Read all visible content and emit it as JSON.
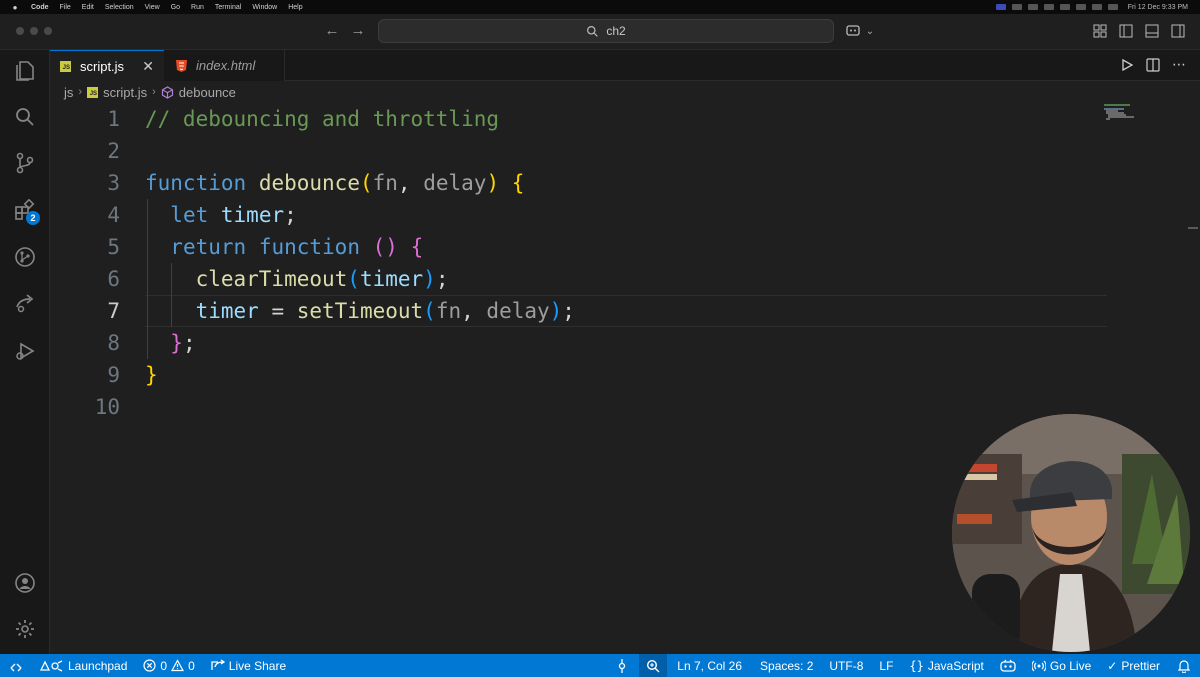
{
  "menubar": {
    "app": "Code",
    "items": [
      "File",
      "Edit",
      "Selection",
      "View",
      "Go",
      "Run",
      "Terminal",
      "Window",
      "Help"
    ],
    "clock": "Fri 12 Dec 9:33 PM"
  },
  "titlebar": {
    "search_text": "ch2"
  },
  "activitybar": {
    "extensions_badge": "2"
  },
  "tabs": [
    {
      "label": "script.js",
      "active": true
    },
    {
      "label": "index.html",
      "active": false
    }
  ],
  "breadcrumb": {
    "folder": "js",
    "file": "script.js",
    "symbol": "debounce"
  },
  "editor": {
    "current_line": 7,
    "line_numbers": [
      "1",
      "2",
      "3",
      "4",
      "5",
      "6",
      "7",
      "8",
      "9",
      "10"
    ],
    "lines": [
      [
        {
          "t": "// debouncing and throttling",
          "c": "com"
        }
      ],
      [],
      [
        {
          "t": "function",
          "c": "kw"
        },
        {
          "t": " ",
          "c": "plain"
        },
        {
          "t": "debounce",
          "c": "fn"
        },
        {
          "t": "(",
          "c": "p1"
        },
        {
          "t": "fn",
          "c": "dim"
        },
        {
          "t": ", ",
          "c": "plain"
        },
        {
          "t": "delay",
          "c": "dim"
        },
        {
          "t": ")",
          "c": "p1"
        },
        {
          "t": " ",
          "c": "plain"
        },
        {
          "t": "{",
          "c": "p1"
        }
      ],
      [
        {
          "t": "  ",
          "c": "plain"
        },
        {
          "t": "let",
          "c": "kw"
        },
        {
          "t": " ",
          "c": "plain"
        },
        {
          "t": "timer",
          "c": "par"
        },
        {
          "t": ";",
          "c": "plain"
        }
      ],
      [
        {
          "t": "  ",
          "c": "plain"
        },
        {
          "t": "return",
          "c": "kw"
        },
        {
          "t": " ",
          "c": "plain"
        },
        {
          "t": "function",
          "c": "kw"
        },
        {
          "t": " ",
          "c": "plain"
        },
        {
          "t": "()",
          "c": "p2"
        },
        {
          "t": " ",
          "c": "plain"
        },
        {
          "t": "{",
          "c": "p2"
        }
      ],
      [
        {
          "t": "    ",
          "c": "plain"
        },
        {
          "t": "clearTimeout",
          "c": "fn"
        },
        {
          "t": "(",
          "c": "p3"
        },
        {
          "t": "timer",
          "c": "par"
        },
        {
          "t": ")",
          "c": "p3"
        },
        {
          "t": ";",
          "c": "plain"
        }
      ],
      [
        {
          "t": "    ",
          "c": "plain"
        },
        {
          "t": "timer",
          "c": "par"
        },
        {
          "t": " = ",
          "c": "plain"
        },
        {
          "t": "setTimeout",
          "c": "fn"
        },
        {
          "t": "(",
          "c": "p3"
        },
        {
          "t": "fn",
          "c": "dim"
        },
        {
          "t": ", ",
          "c": "plain"
        },
        {
          "t": "delay",
          "c": "dim"
        },
        {
          "t": ")",
          "c": "p3"
        },
        {
          "t": ";",
          "c": "plain"
        }
      ],
      [
        {
          "t": "  ",
          "c": "plain"
        },
        {
          "t": "}",
          "c": "p2"
        },
        {
          "t": ";",
          "c": "plain"
        }
      ],
      [
        {
          "t": "}",
          "c": "p1"
        }
      ],
      []
    ]
  },
  "statusbar": {
    "launchpad": "Launchpad",
    "errors": "0",
    "warnings": "0",
    "live_share": "Live Share",
    "position": "Ln 7, Col 26",
    "spaces": "Spaces: 2",
    "encoding": "UTF-8",
    "eol": "LF",
    "language": "JavaScript",
    "go_live": "Go Live",
    "prettier": "Prettier"
  },
  "colors": {
    "accent": "#0078d4",
    "editor_bg": "#1f1f1f",
    "sidebar_bg": "#181818"
  }
}
